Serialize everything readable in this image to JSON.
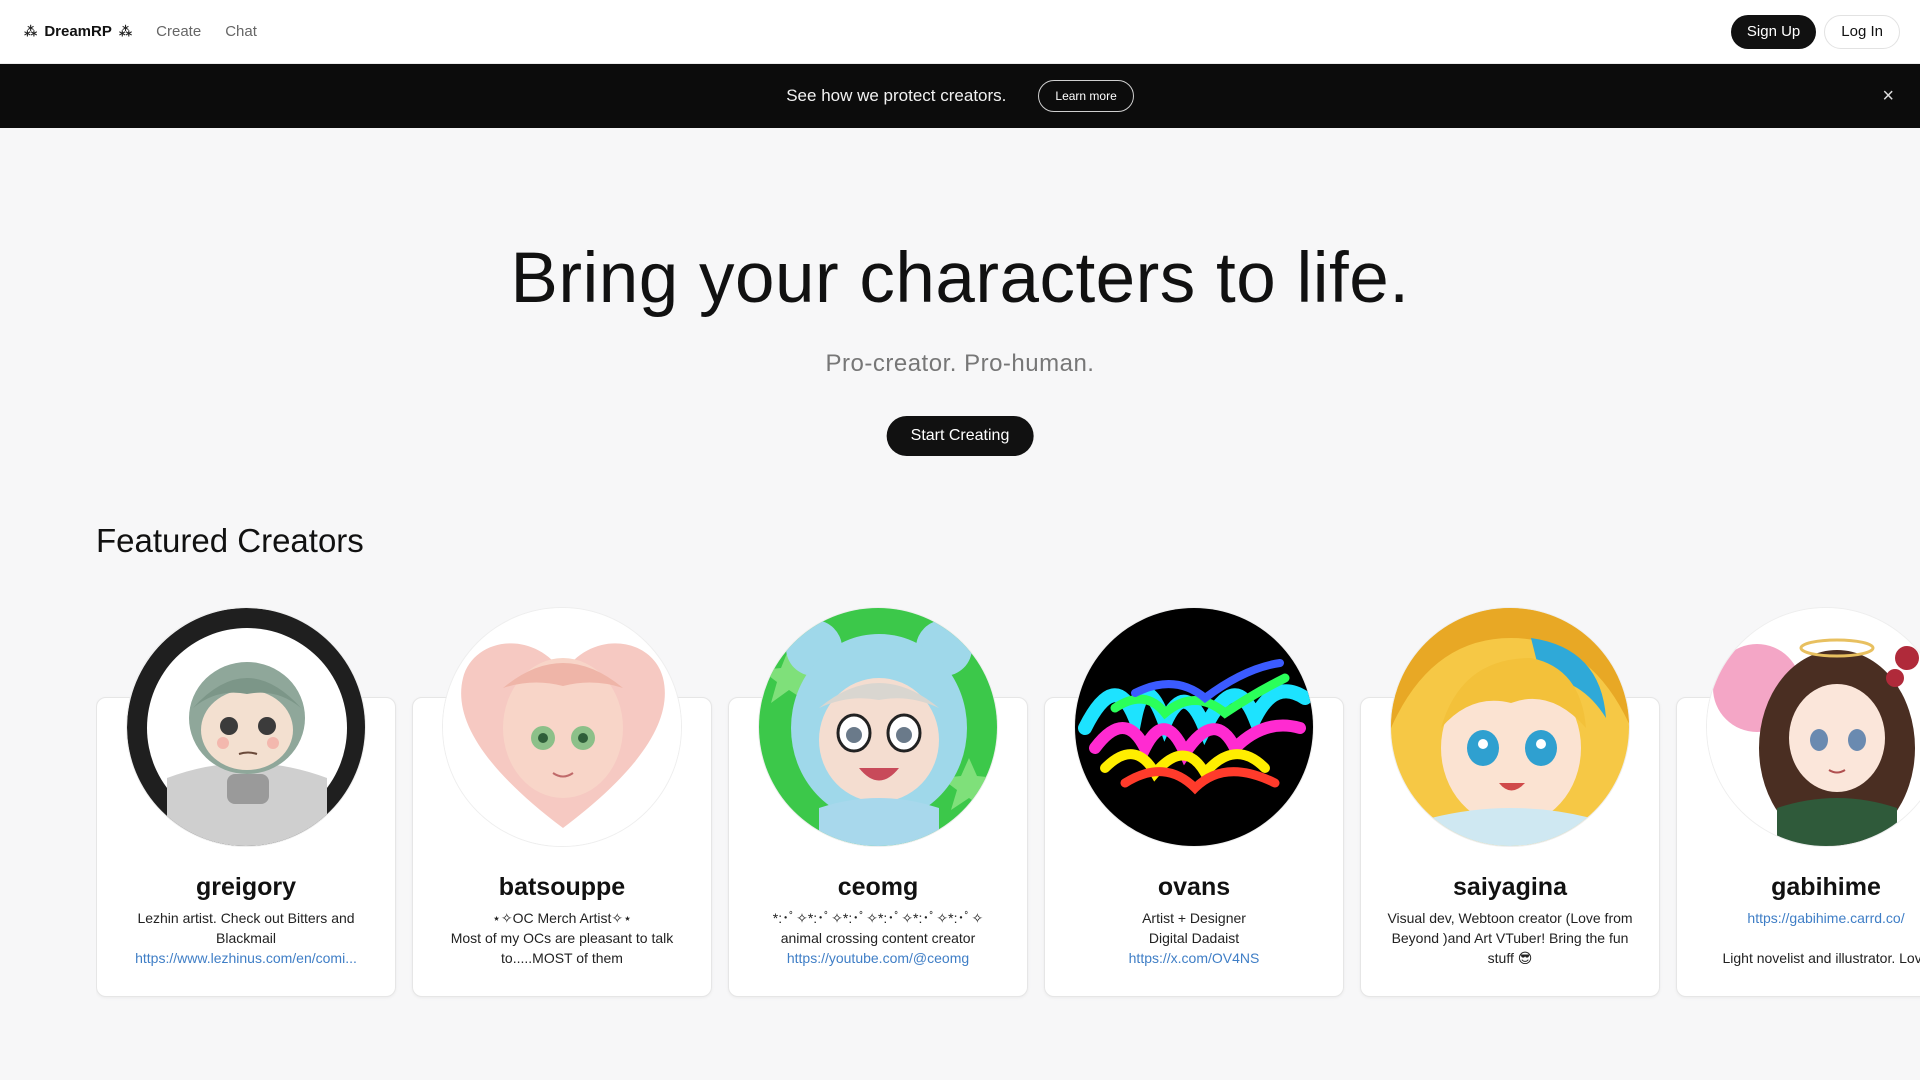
{
  "nav": {
    "brand": "DreamRP",
    "links": [
      "Create",
      "Chat"
    ],
    "signup_label": "Sign Up",
    "login_label": "Log In"
  },
  "banner": {
    "text": "See how we protect creators.",
    "button_label": "Learn more",
    "close_icon": "×"
  },
  "hero": {
    "title": "Bring your characters to life.",
    "subtitle": "Pro-creator. Pro-human.",
    "cta_label": "Start Creating"
  },
  "featured": {
    "title": "Featured Creators",
    "creators": [
      {
        "name": "greigory",
        "bio": [
          "Lezhin artist. Check out Bitters and Blackmail"
        ],
        "link": "https://www.lezhinus.com/en/comi..."
      },
      {
        "name": "batsouppe",
        "bio": [
          "⋆✧OC Merch Artist✧⋆",
          "Most of my OCs are pleasant to talk to.....MOST of them"
        ],
        "link": ""
      },
      {
        "name": "ceomg",
        "bio": [
          "*:･ﾟ✧*:･ﾟ✧*:･ﾟ✧*:･ﾟ✧*:･ﾟ✧*:･ﾟ✧",
          "animal crossing content creator"
        ],
        "link": "https://youtube.com/@ceomg"
      },
      {
        "name": "ovans",
        "bio": [
          "Artist + Designer",
          "Digital Dadaist"
        ],
        "link": "https://x.com/OV4NS"
      },
      {
        "name": "saiyagina",
        "bio": [
          "Visual dev, Webtoon creator (Love from Beyond )and Art VTuber! Bring the fun stuff 😎"
        ],
        "link": ""
      },
      {
        "name": "gabihime",
        "link_first": "https://gabihime.carrd.co/",
        "bio": [
          "Light novelist and illustrator. Love"
        ],
        "link": ""
      }
    ]
  },
  "colors": {
    "accent": "#111111",
    "link": "#3f7ec6",
    "banner_bg": "#0c0c0c",
    "page_bg": "#f7f7f8"
  }
}
